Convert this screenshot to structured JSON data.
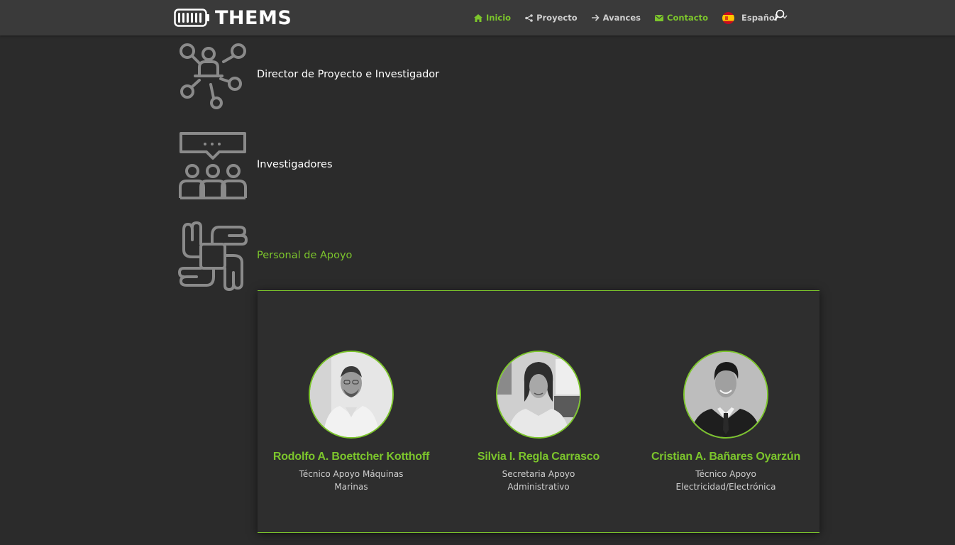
{
  "brand": {
    "name": "THEMS"
  },
  "nav": {
    "items": [
      {
        "label": "Inicio",
        "icon": "home-icon",
        "state": "active"
      },
      {
        "label": "Proyecto",
        "icon": "share-icon"
      },
      {
        "label": "Avances",
        "icon": "arrow-right-icon"
      },
      {
        "label": "Contacto",
        "icon": "envelope-icon"
      }
    ],
    "language": "Español",
    "language_flag": "spain-flag-icon"
  },
  "sections": [
    {
      "title": "Director de Proyecto e Investigador",
      "icon": "network-people-icon"
    },
    {
      "title": "Investigadores",
      "icon": "group-discussion-icon"
    },
    {
      "title": "Personal de Apoyo",
      "icon": "joined-hands-icon"
    }
  ],
  "team": [
    {
      "name": "Rodolfo A. Boettcher Kotthoff",
      "role": "Técnico Apoyo Máquinas Marinas"
    },
    {
      "name": "Silvia I. Regla Carrasco",
      "role": "Secretaria Apoyo Administrativo"
    },
    {
      "name": "Cristian A. Bañares Oyarzún",
      "role": "Técnico Apoyo Electricidad/Electrónica"
    }
  ],
  "colors": {
    "accent": "#7cc52c",
    "background": "#2b2b2b",
    "header": "#3a3a3a",
    "icon": "#8a8a8a"
  }
}
